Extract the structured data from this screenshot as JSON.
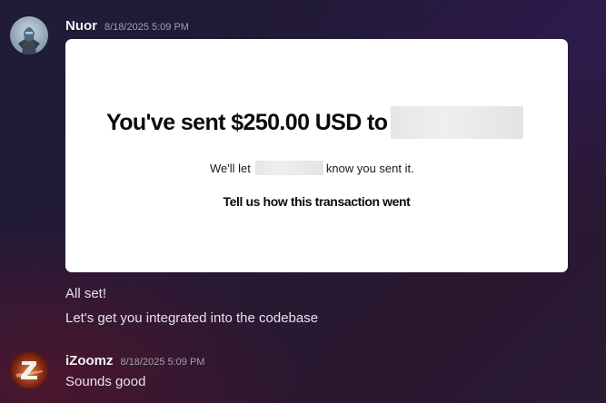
{
  "messages": [
    {
      "username": "Nuor",
      "timestamp": "8/18/2025 5:09 PM",
      "avatar_icon": "robot-knight-avatar",
      "embed": {
        "headline": "You've sent $250.00 USD to",
        "sub_prefix": "We'll let",
        "sub_suffix": "know you sent it.",
        "link_text": "Tell us how this transaction went"
      },
      "lines": [
        "All set!",
        "Let's get you integrated into the codebase"
      ]
    },
    {
      "username": "iZoomz",
      "timestamp": "8/18/2025 5:09 PM",
      "avatar_icon": "z-letter-avatar",
      "lines": [
        "Sounds good"
      ]
    }
  ],
  "colors": {
    "username": "#f2f3f5",
    "timestamp": "#9ea2aa",
    "message_text": "#e3e5e8",
    "embed_background": "#ffffff"
  }
}
